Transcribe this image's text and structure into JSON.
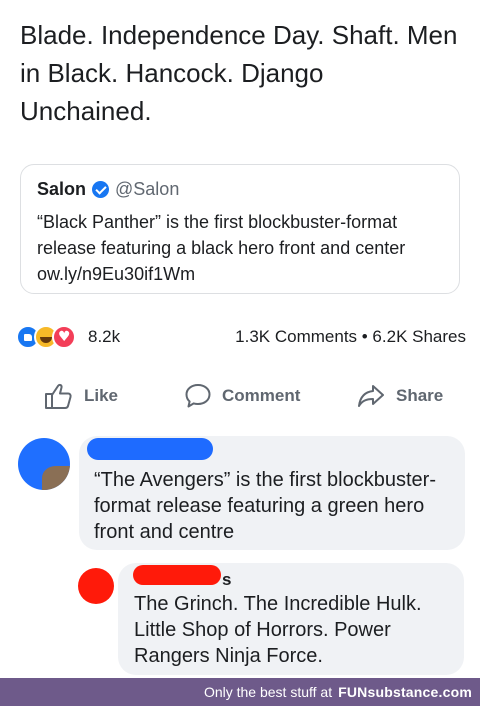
{
  "post": {
    "text": "Blade. Independence Day. Shaft. Men in Black. Hancock. Django Unchained."
  },
  "quote": {
    "author": "Salon",
    "handle": "@Salon",
    "body": "“Black Panther” is the first blockbuster-format release featuring a black hero front and center ow.ly/n9Eu30if1Wm"
  },
  "stats": {
    "reaction_icons": [
      "like-icon",
      "haha-icon",
      "love-icon"
    ],
    "reaction_count": "8.2k",
    "comments_shares": "1.3K Comments • 6.2K Shares"
  },
  "actions": {
    "like": "Like",
    "comment": "Comment",
    "share": "Share"
  },
  "comments": [
    {
      "avatar_color": "#1f6fff",
      "name_redaction_color": "#1e6bff",
      "text": "“The Avengers” is the first blockbuster-format release featuring a green hero front and centre"
    },
    {
      "avatar_color": "#ff1a0a",
      "name_redaction_color": "#ff1a0a",
      "name_tail": "s",
      "text": "The Grinch. The Incredible Hulk. Little Shop of Horrors. Power Rangers Ninja Force."
    }
  ],
  "footer": {
    "prefix": "Only the best stuff at",
    "brand": "FUNsubstance.com",
    "bar_color": "#6e5a8a"
  },
  "colors": {
    "facebook_blue": "#1877f2",
    "text": "#1c1e21",
    "secondary_text": "#606770",
    "bubble": "#f0f2f5"
  }
}
